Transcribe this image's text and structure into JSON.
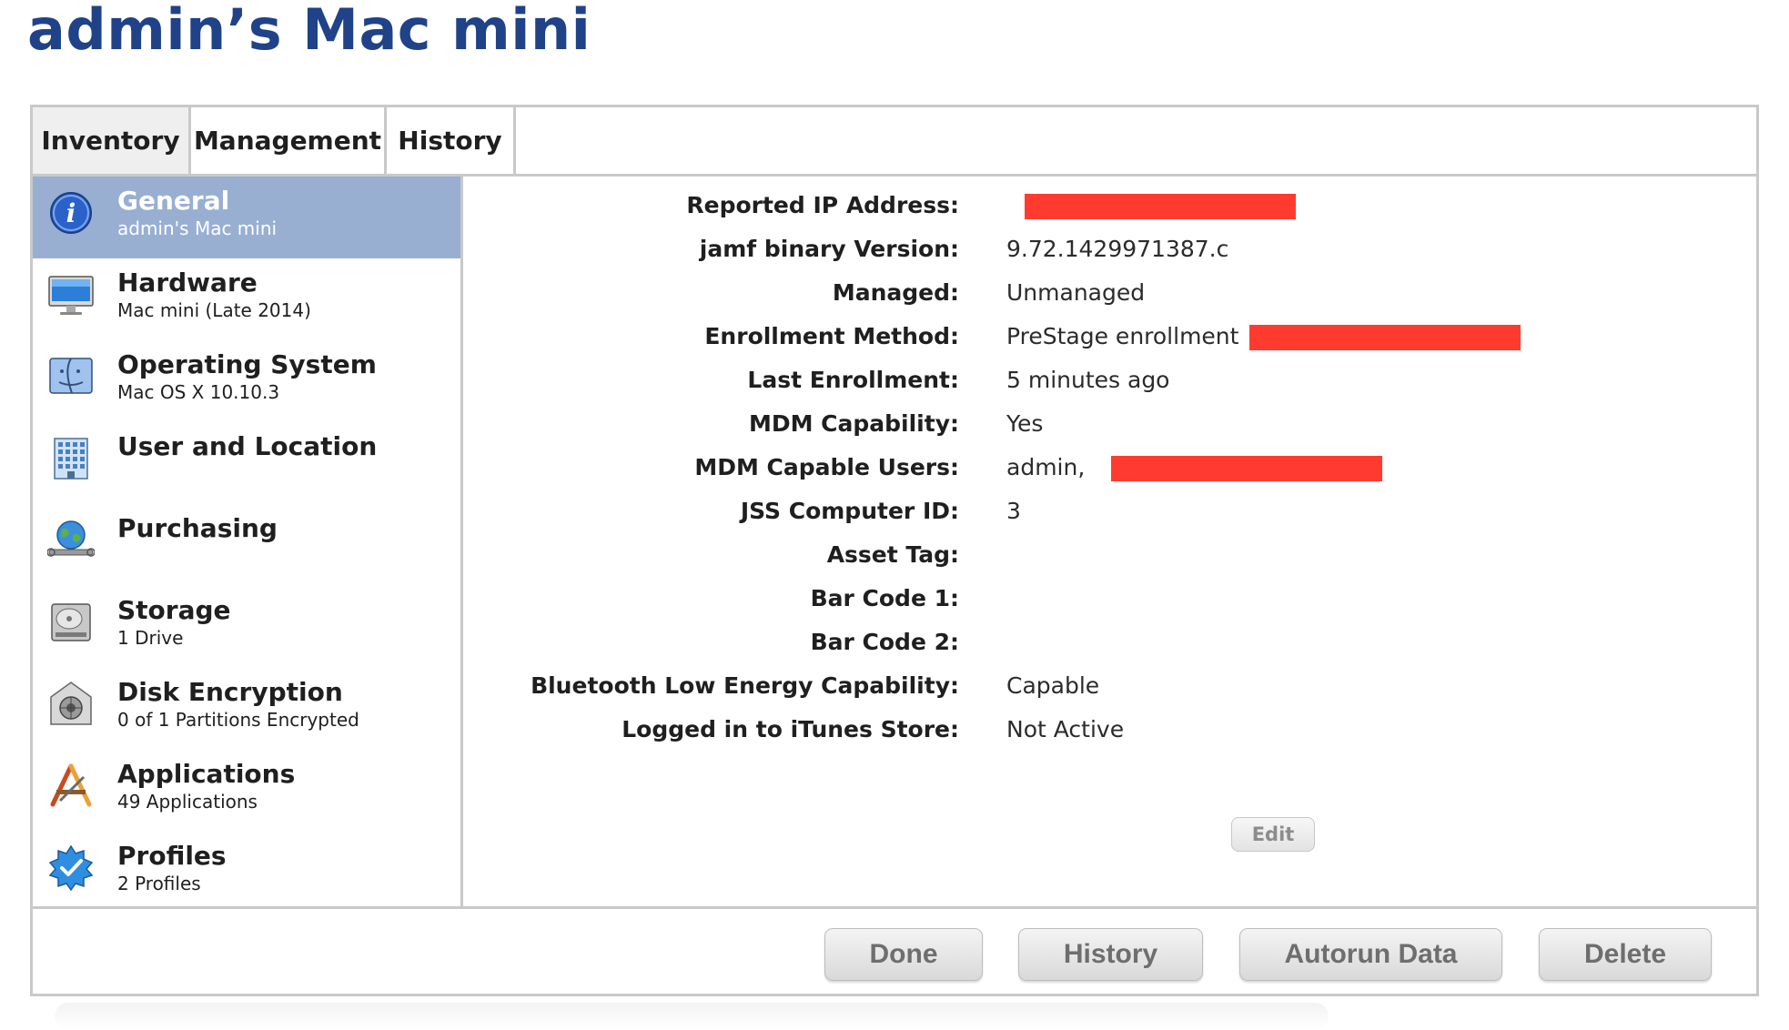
{
  "page": {
    "title": "admin’s Mac mini"
  },
  "tabs": [
    {
      "label": "Inventory",
      "active": true
    },
    {
      "label": "Management",
      "active": false
    },
    {
      "label": "History",
      "active": false
    }
  ],
  "sidebar": {
    "items": [
      {
        "title": "General",
        "subtitle": "admin's Mac mini",
        "icon": "info-icon",
        "selected": true
      },
      {
        "title": "Hardware",
        "subtitle": "Mac mini (Late 2014)",
        "icon": "monitor-icon"
      },
      {
        "title": "Operating System",
        "subtitle": "Mac OS X 10.10.3",
        "icon": "finder-icon"
      },
      {
        "title": "User and Location",
        "subtitle": "",
        "icon": "building-icon"
      },
      {
        "title": "Purchasing",
        "subtitle": "",
        "icon": "globe-wrench-icon"
      },
      {
        "title": "Storage",
        "subtitle": "1 Drive",
        "icon": "hard-drive-icon"
      },
      {
        "title": "Disk Encryption",
        "subtitle": "0 of 1 Partitions Encrypted",
        "icon": "lock-vault-icon"
      },
      {
        "title": "Applications",
        "subtitle": "49 Applications",
        "icon": "app-store-icon"
      },
      {
        "title": "Profiles",
        "subtitle": "2 Profiles",
        "icon": "verified-badge-icon"
      }
    ]
  },
  "details": {
    "fields": [
      {
        "label": "Reported IP Address:",
        "value": "",
        "redacted": true
      },
      {
        "label": "jamf binary Version:",
        "value": "9.72.1429971387.c"
      },
      {
        "label": "Managed:",
        "value": "Unmanaged"
      },
      {
        "label": "Enrollment Method:",
        "value": "PreStage enrollment",
        "redacted": true
      },
      {
        "label": "Last Enrollment:",
        "value": "5 minutes ago"
      },
      {
        "label": "MDM Capability:",
        "value": "Yes"
      },
      {
        "label": "MDM Capable Users:",
        "value": "admin,",
        "redacted": true
      },
      {
        "label": "JSS Computer ID:",
        "value": "3"
      },
      {
        "label": "Asset Tag:",
        "value": ""
      },
      {
        "label": "Bar Code 1:",
        "value": ""
      },
      {
        "label": "Bar Code 2:",
        "value": ""
      },
      {
        "label": "Bluetooth Low Energy Capability:",
        "value": "Capable"
      },
      {
        "label": "Logged in to iTunes Store:",
        "value": "Not Active"
      }
    ],
    "edit_label": "Edit"
  },
  "footer": {
    "done_label": "Done",
    "history_label": "History",
    "autorun_label": "Autorun Data",
    "delete_label": "Delete"
  },
  "colors": {
    "title": "#1f4288",
    "selected_bg": "#98afd2",
    "redaction": "#ff3b30",
    "border": "#c9c9c9"
  }
}
